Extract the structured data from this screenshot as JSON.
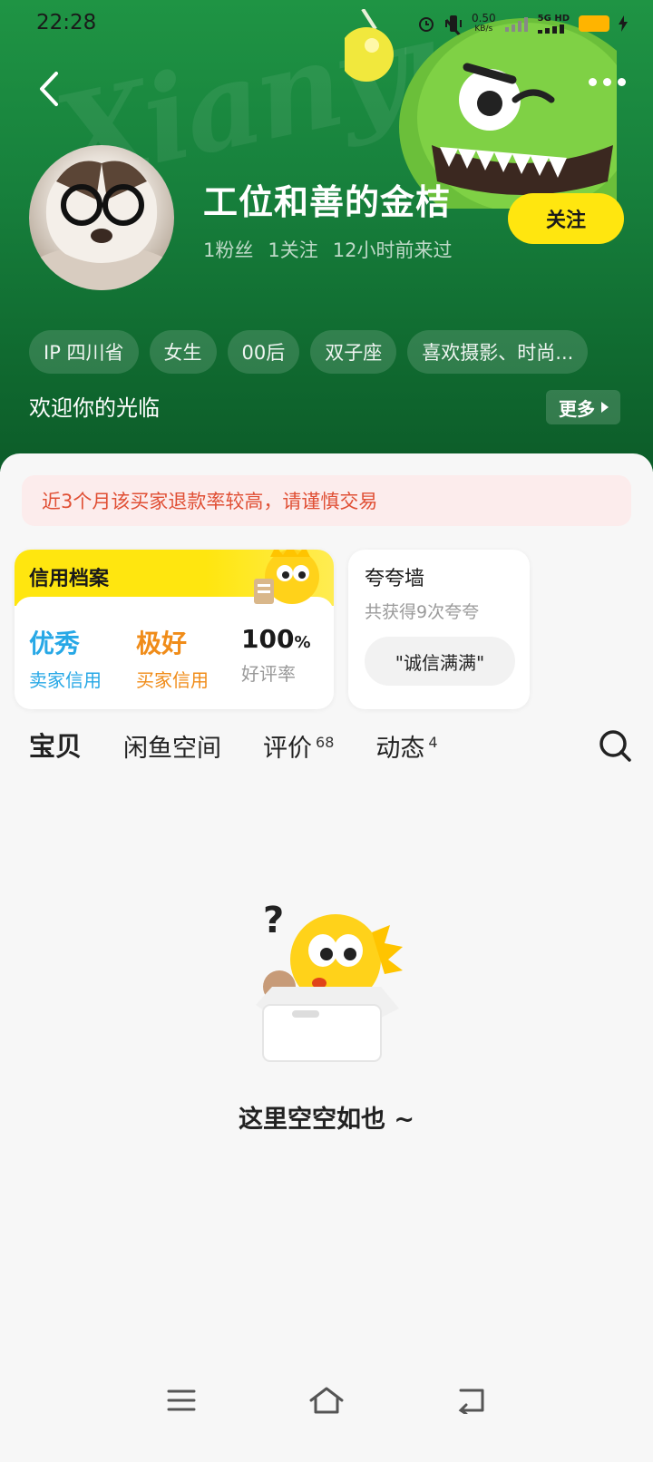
{
  "status_bar": {
    "time": "22:28",
    "net_speed": "0.50",
    "net_unit": "KB/s",
    "network": "5G HD"
  },
  "header": {
    "watermark": "Xianyu",
    "username": "工位和善的金桔",
    "stats": [
      "1粉丝",
      "1关注",
      "12小时前来过"
    ],
    "follow_label": "关注",
    "tags": [
      "IP 四川省",
      "女生",
      "00后",
      "双子座",
      "喜欢摄影、时尚..."
    ],
    "welcome": "欢迎你的光临",
    "more_label": "更多"
  },
  "warning": "近3个月该买家退款率较高，请谨慎交易",
  "credit": {
    "title": "信用档案",
    "items": [
      {
        "value": "优秀",
        "label": "卖家信用",
        "color": "#27a8e6"
      },
      {
        "value": "极好",
        "label": "买家信用",
        "color": "#f08c19"
      },
      {
        "value": "100",
        "suffix": "%",
        "label": "好评率",
        "color": "#1a1a1a"
      }
    ]
  },
  "praise": {
    "title": "夸夸墙",
    "subtitle": "共获得9次夸夸",
    "chip": "\"诚信满满\""
  },
  "tabs": [
    {
      "label": "宝贝",
      "count": ""
    },
    {
      "label": "闲鱼空间",
      "count": ""
    },
    {
      "label": "评价",
      "count": "68"
    },
    {
      "label": "动态",
      "count": "4"
    }
  ],
  "empty_text": "这里空空如也 ~",
  "colors": {
    "brand_yellow": "#ffe60f",
    "header_green": "#17803c",
    "warning_red": "#e04f34"
  }
}
